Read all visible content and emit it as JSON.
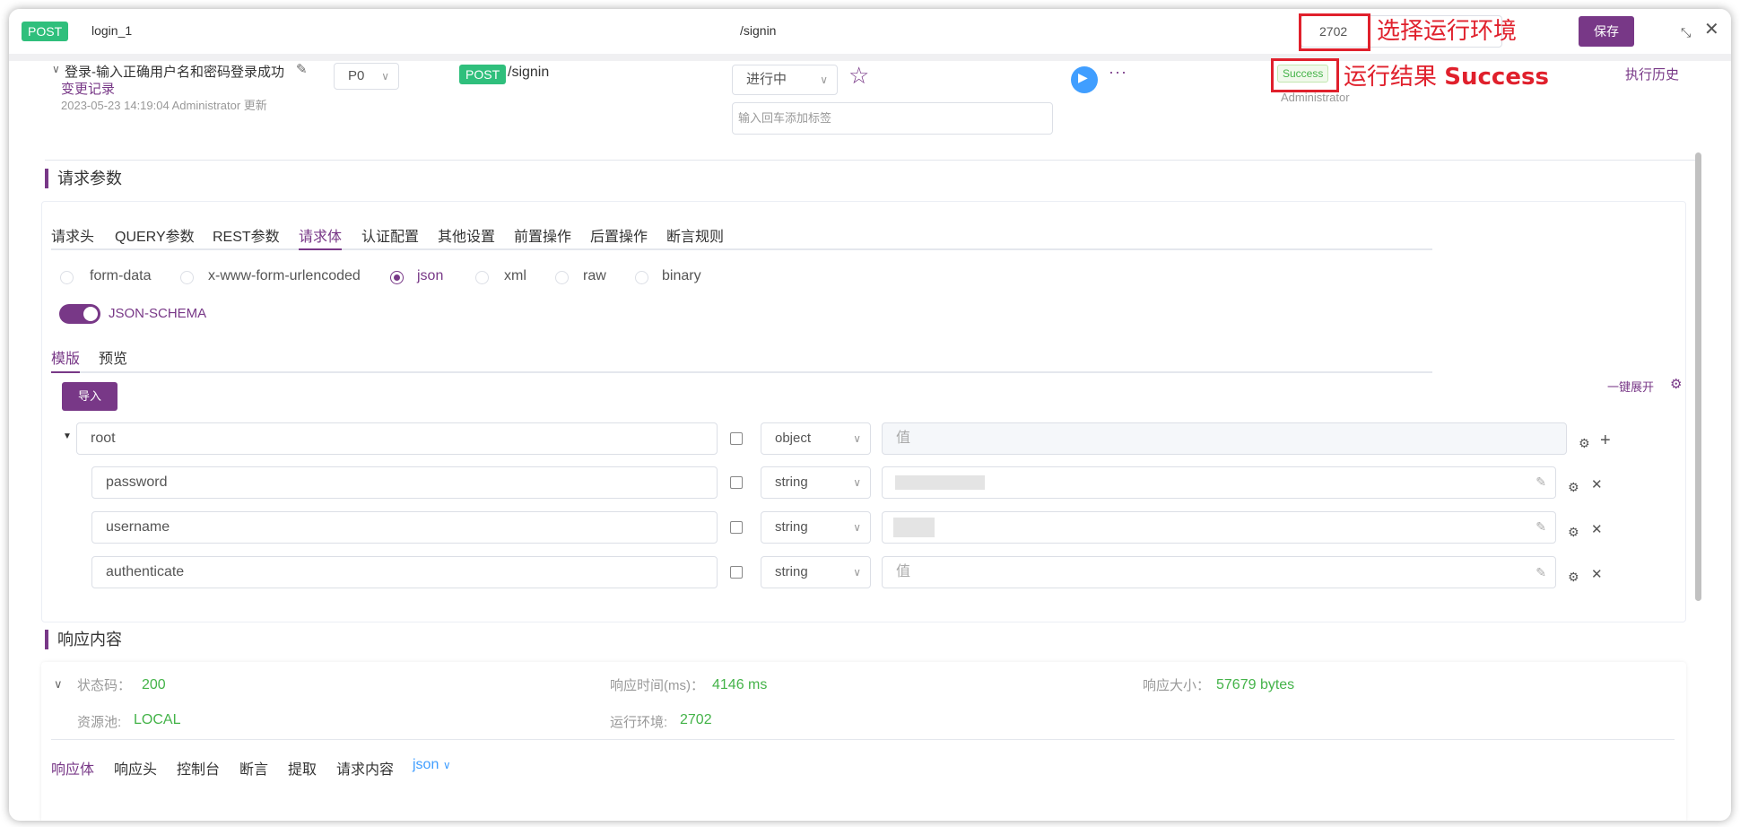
{
  "topbar": {
    "method": "POST",
    "name": "login_1",
    "path": "/signin",
    "environment": "2702",
    "env_annotation": "选择运行环境",
    "save_label": "保存",
    "minimize_icon": "shrink-icon",
    "close_icon": "close-icon"
  },
  "header": {
    "case_name": "登录-输入正确用户名和密码登录成功",
    "change_log": "变更记录",
    "updated_info": "2023-05-23 14:19:04 Administrator 更新",
    "priority": "P0",
    "method": "POST",
    "path": "/signin",
    "status": "进行中",
    "tag_placeholder": "输入回车添加标签",
    "result_badge": "Success",
    "result_annotation_prefix": "运行结果",
    "result_annotation_value": "Success",
    "executor": "Administrator",
    "history_link": "执行历史"
  },
  "request": {
    "section_title": "请求参数",
    "tabs": [
      "请求头",
      "QUERY参数",
      "REST参数",
      "请求体",
      "认证配置",
      "其他设置",
      "前置操作",
      "后置操作",
      "断言规则"
    ],
    "active_tab": "请求体",
    "body_types": [
      "form-data",
      "x-www-form-urlencoded",
      "json",
      "xml",
      "raw",
      "binary"
    ],
    "selected_body_type": "json",
    "schema_toggle_label": "JSON-SCHEMA",
    "schema_tabs": [
      "模版",
      "预览"
    ],
    "import_label": "导入",
    "expand_all_label": "一键展开",
    "value_placeholder": "值",
    "rows": [
      {
        "field": "root",
        "type": "object"
      },
      {
        "field": "password",
        "type": "string"
      },
      {
        "field": "username",
        "type": "string"
      },
      {
        "field": "authenticate",
        "type": "string"
      }
    ]
  },
  "response": {
    "section_title": "响应内容",
    "status_code_label": "状态码：",
    "status_code": "200",
    "response_time_label": "响应时间(ms)：",
    "response_time": "4146 ms",
    "response_size_label": "响应大小：",
    "response_size": "57679 bytes",
    "pool_label": "资源池:",
    "pool": "LOCAL",
    "env_label": "运行环境:",
    "env": "2702",
    "tabs": [
      "响应体",
      "响应头",
      "控制台",
      "断言",
      "提取",
      "请求内容"
    ],
    "format": "json"
  },
  "colors": {
    "brand": "#783887",
    "post": "#2fbf7c",
    "success": "#44b349",
    "annotation": "#e0202c",
    "run": "#409eff"
  }
}
